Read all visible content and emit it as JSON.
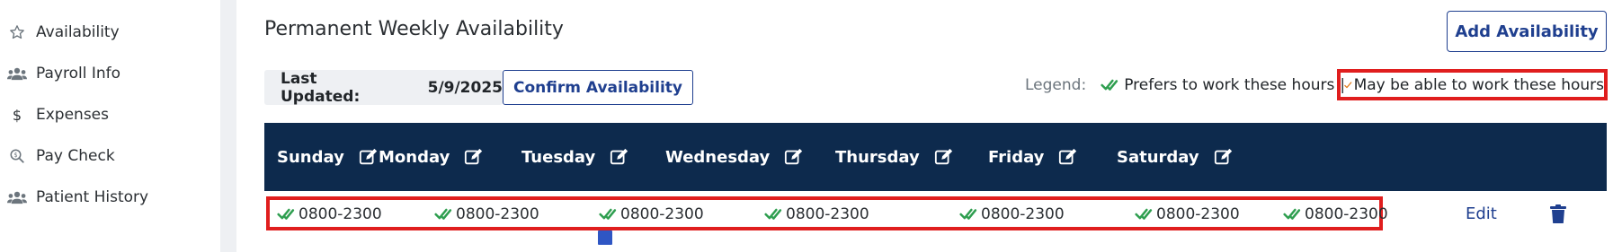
{
  "sidebar": {
    "items": [
      {
        "label": "Availability",
        "icon": "star-icon"
      },
      {
        "label": "Payroll Info",
        "icon": "users-icon"
      },
      {
        "label": "Expenses",
        "icon": "dollar-icon"
      },
      {
        "label": "Pay Check",
        "icon": "search-dollar-icon"
      },
      {
        "label": "Patient History",
        "icon": "users-icon"
      }
    ]
  },
  "header": {
    "title": "Permanent Weekly Availability",
    "add_button": "Add Availability"
  },
  "updated": {
    "label": "Last Updated:",
    "date": "5/9/2025",
    "confirm_button": "Confirm Availability"
  },
  "legend": {
    "label": "Legend:",
    "prefers": "Prefers to work these hours",
    "separator": "|",
    "maybe": "May be able to work these hours"
  },
  "table": {
    "days": [
      "Sunday",
      "Monday",
      "Tuesday",
      "Wednesday",
      "Thursday",
      "Friday",
      "Saturday"
    ],
    "row": [
      "0800-2300",
      "0800-2300",
      "0800-2300",
      "0800-2300",
      "0800-2300",
      "0800-2300",
      "0800-2300"
    ],
    "edit_link": "Edit"
  },
  "colors": {
    "header_bg": "#0d2a4d",
    "accent": "#1f3f8f",
    "prefers_check": "#2e9e4f",
    "maybe_check": "#e07b1a",
    "highlight": "#e01e1e"
  }
}
